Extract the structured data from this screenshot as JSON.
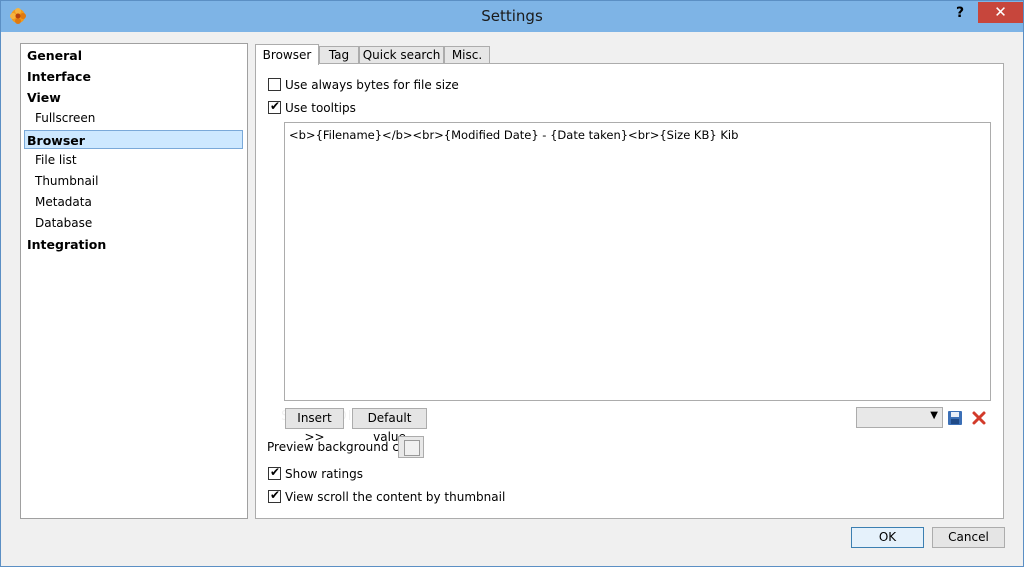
{
  "window": {
    "title": "Settings",
    "help_label": "?",
    "close_label": "✕"
  },
  "nav": {
    "items": [
      {
        "label": "General",
        "level": 0
      },
      {
        "label": "Interface",
        "level": 0
      },
      {
        "label": "View",
        "level": 0
      },
      {
        "label": "Fullscreen",
        "level": 1
      },
      {
        "label": "Browser",
        "level": 0,
        "selected": true
      },
      {
        "label": "File list",
        "level": 1
      },
      {
        "label": "Thumbnail",
        "level": 1
      },
      {
        "label": "Metadata",
        "level": 1
      },
      {
        "label": "Database",
        "level": 1
      },
      {
        "label": "Integration",
        "level": 0
      }
    ]
  },
  "tabs": [
    {
      "label": "Browser",
      "active": true
    },
    {
      "label": "Tag",
      "active": false
    },
    {
      "label": "Quick search",
      "active": false
    },
    {
      "label": "Misc.",
      "active": false
    }
  ],
  "browser": {
    "bytes_checkbox": {
      "label": "Use always bytes for file size",
      "checked": false
    },
    "tooltips_checkbox": {
      "label": "Use tooltips",
      "checked": true
    },
    "tooltip_template": "<b>{Filename}</b><br>{Modified Date} - {Date taken}<br>{Size KB} Kib",
    "insert_label": "Insert >>",
    "default_label": "Default value",
    "preset_value": "",
    "preview_bg_label": "Preview background color",
    "show_ratings": {
      "label": "Show ratings",
      "checked": true
    },
    "scroll_thumb": {
      "label": "View scroll the content by thumbnail",
      "checked": true
    }
  },
  "footer": {
    "ok_label": "OK",
    "cancel_label": "Cancel"
  },
  "colors": {
    "titlebar": "#7eb4e6",
    "close": "#c7463c",
    "selection": "#cde8ff"
  }
}
